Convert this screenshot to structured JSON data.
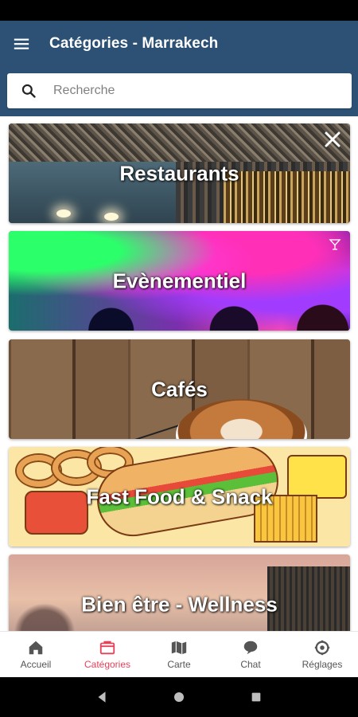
{
  "app_bar": {
    "title": "Catégories - Marrakech",
    "menu_icon": "hamburger-menu-icon"
  },
  "search": {
    "placeholder": "Recherche",
    "value": "",
    "icon": "search-icon"
  },
  "categories": [
    {
      "title": "Restaurants",
      "icon": "restaurant-cutlery-icon"
    },
    {
      "title": "Evènementiel",
      "icon": "cocktail-glass-icon"
    },
    {
      "title": "Cafés"
    },
    {
      "title": "Fast Food & Snack"
    },
    {
      "title": "Bien être - Wellness"
    }
  ],
  "bottom_nav": {
    "items": [
      {
        "label": "Accueil",
        "icon": "home-icon"
      },
      {
        "label": "Catégories",
        "icon": "categories-icon",
        "active": true
      },
      {
        "label": "Carte",
        "icon": "map-icon"
      },
      {
        "label": "Chat",
        "icon": "chat-bubble-icon"
      },
      {
        "label": "Réglages",
        "icon": "settings-icon"
      }
    ]
  },
  "colors": {
    "app_bar": "#2c5175",
    "active_tab": "#e8405a",
    "inactive_tab": "#555555"
  }
}
